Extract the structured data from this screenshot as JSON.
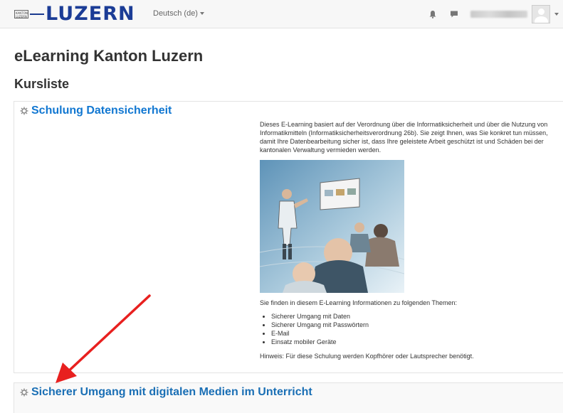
{
  "header": {
    "logo_text": "LUZERN",
    "logo_seal_text": "KANTON LUZERN",
    "language": "Deutsch (de)",
    "icons": [
      "bell-icon",
      "chat-icon"
    ]
  },
  "page": {
    "site_title": "eLearning Kanton Luzern",
    "section_title": "Kursliste"
  },
  "courses": [
    {
      "name": "Schulung Datensicherheit",
      "summary": "Dieses E-Learning basiert auf der Verordnung über die Informatiksicherheit und über die Nutzung von Informatikmitteln (Informatiksicherheitsverordnung 26b). Sie zeigt Ihnen, was Sie konkret tun müssen, damit Ihre Datenbearbeitung sicher ist, dass Ihre geleistete Arbeit geschützt ist und Schäden bei der kantonalen Verwaltung vermieden werden.",
      "topics_intro": "Sie finden in diesem E-Learning Informationen zu folgenden Themen:",
      "topics": [
        "Sicherer Umgang mit Daten",
        "Sicherer Umgang mit Passwörtern",
        "E-Mail",
        "Einsatz mobiler Geräte"
      ],
      "hint": "Hinweis: Für diese Schulung werden Kopfhörer oder Lautsprecher benötigt."
    },
    {
      "name": "Sicherer Umgang mit digitalen Medien im Unterricht"
    }
  ],
  "colors": {
    "link": "#1177d1",
    "logo": "#1b3c96",
    "annotation_arrow": "#e8201f"
  }
}
